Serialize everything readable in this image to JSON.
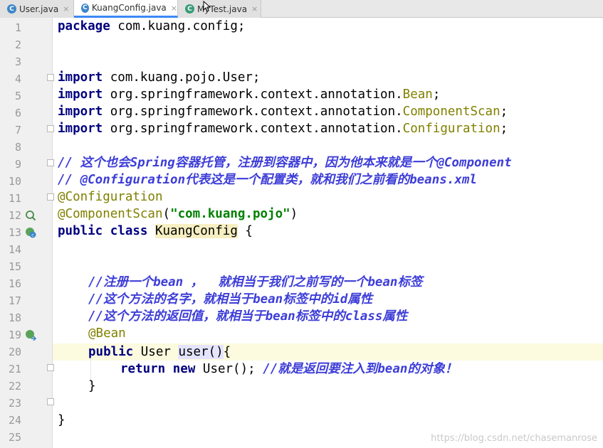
{
  "tabs": [
    {
      "label": "User.java",
      "icon": "C",
      "active": false
    },
    {
      "label": "KuangConfig.java",
      "icon": "C",
      "active": true
    },
    {
      "label": "MyTest.java",
      "icon": "C",
      "active": false
    }
  ],
  "close_glyph": "×",
  "line_numbers": [
    "1",
    "2",
    "3",
    "4",
    "5",
    "6",
    "7",
    "8",
    "9",
    "10",
    "11",
    "12",
    "13",
    "14",
    "15",
    "16",
    "17",
    "18",
    "19",
    "20",
    "21",
    "22",
    "23",
    "24",
    "25"
  ],
  "code": {
    "l1_kw": "package",
    "l1_rest": " com.kuang.config;",
    "l4_kw": "import",
    "l4_rest": " com.kuang.pojo.User;",
    "l5_kw": "import",
    "l5_rest": " org.springframework.context.annotation.",
    "l5_cls": "Bean",
    "l5_end": ";",
    "l6_kw": "import",
    "l6_rest": " org.springframework.context.annotation.",
    "l6_cls": "ComponentScan",
    "l6_end": ";",
    "l7_kw": "import",
    "l7_rest": " org.springframework.context.annotation.",
    "l7_cls": "Configuration",
    "l7_end": ";",
    "l9": "// 这个也会Spring容器托管，注册到容器中，因为他本来就是一个@Component",
    "l10": "// @Configuration代表这是一个配置类，就和我们之前看的beans.xml",
    "l11": "@Configuration",
    "l12_ann": "@ComponentScan",
    "l12_open": "(",
    "l12_str": "\"com.kuang.pojo\"",
    "l12_close": ")",
    "l13_kw": "public class",
    "l13_sp": " ",
    "l13_name": "KuangConfig",
    "l13_end": " {",
    "l16": "//注册一个bean ，  就相当于我们之前写的一个bean标签",
    "l17": "//这个方法的名字，就相当于bean标签中的id属性",
    "l18": "//这个方法的返回值，就相当于bean标签中的class属性",
    "l19": "@Bean",
    "l20_kw": "public",
    "l20_type": " User ",
    "l20_name_a": "user",
    "l20_paren": "()",
    "l20_end": "{",
    "l21_kw1": "return",
    "l21_sp": " ",
    "l21_kw2": "new",
    "l21_mid": " User(); ",
    "l21_cmt": "//就是返回要注入到bean的对象！",
    "l22": "}",
    "l24": "}"
  },
  "watermark": "https://blog.csdn.net/chasemanrose",
  "colors": {
    "keyword": "#000080",
    "annotation": "#808000",
    "string": "#008000",
    "comment": "#3d3dd8",
    "current_line": "#fcfadf"
  }
}
